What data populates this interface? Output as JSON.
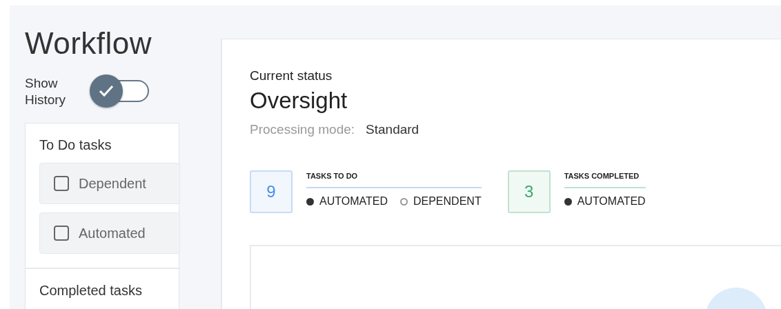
{
  "sidebar": {
    "title": "Workflow",
    "history_toggle": {
      "label": "Show History",
      "on": true
    },
    "sections": [
      {
        "title": "To Do tasks",
        "filters": [
          {
            "label": "Dependent",
            "checked": false
          },
          {
            "label": "Automated",
            "checked": false
          }
        ]
      },
      {
        "title": "Completed tasks"
      }
    ]
  },
  "main": {
    "status_label": "Current status",
    "status": "Oversight",
    "mode_label": "Processing mode:",
    "mode_value": "Standard",
    "stats": [
      {
        "count": "9",
        "title": "TASKS TO DO",
        "color": "#4a8ee8",
        "legend": [
          {
            "label": "AUTOMATED",
            "kind": "filled"
          },
          {
            "label": "DEPENDENT",
            "kind": "hollow"
          }
        ]
      },
      {
        "count": "3",
        "title": "TASKS COMPLETED",
        "color": "#3aa76d",
        "legend": [
          {
            "label": "AUTOMATED",
            "kind": "filled"
          }
        ]
      }
    ]
  }
}
